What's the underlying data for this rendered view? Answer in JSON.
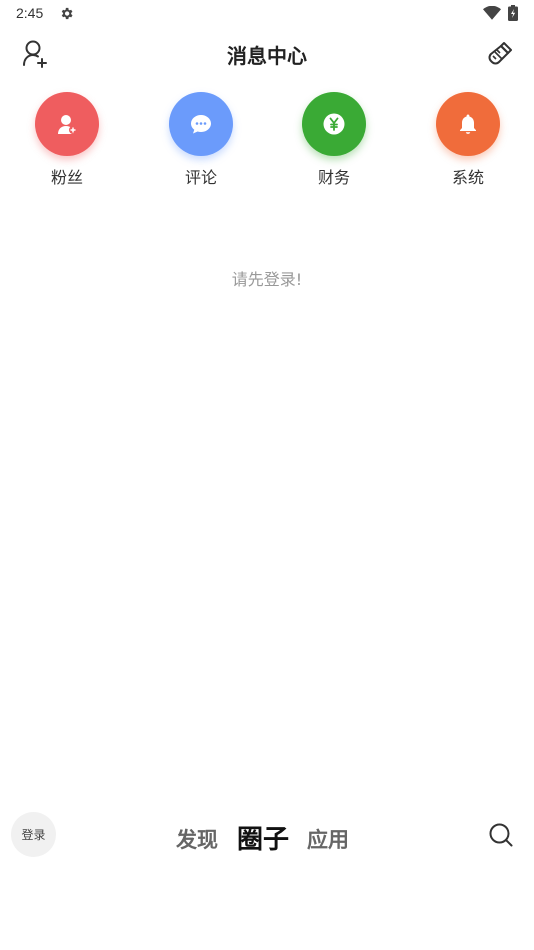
{
  "status_bar": {
    "time": "2:45"
  },
  "header": {
    "title": "消息中心"
  },
  "categories": [
    {
      "label": "粉丝",
      "color": "#ef5d5f",
      "icon": "user-add-icon"
    },
    {
      "label": "评论",
      "color": "#6b9bfb",
      "icon": "chat-bubble-icon"
    },
    {
      "label": "财务",
      "color": "#3aaa35",
      "icon": "yen-coin-icon"
    },
    {
      "label": "系统",
      "color": "#f06c3b",
      "icon": "bell-icon"
    }
  ],
  "empty_message": "请先登录!",
  "bottom_nav": {
    "login_label": "登录",
    "tabs": [
      {
        "label": "发现",
        "active": false
      },
      {
        "label": "圈子",
        "active": true
      },
      {
        "label": "应用",
        "active": false
      }
    ]
  }
}
